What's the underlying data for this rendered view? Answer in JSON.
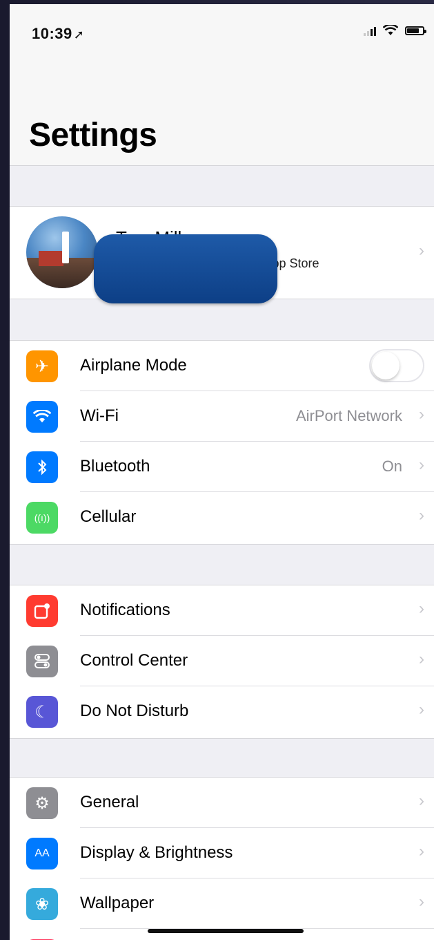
{
  "status_bar": {
    "time": "10:39",
    "location_arrow": "location-arrow-icon",
    "battery_level": 0.7
  },
  "header": {
    "title": "Settings"
  },
  "profile": {
    "name": "Tom Miller",
    "subtitle": "Apple ID, iCloud, iTunes & App Store"
  },
  "groups": {
    "connectivity": [
      {
        "label": "Airplane Mode",
        "icon": "airplane-icon",
        "color": "#ff9500",
        "toggle": false
      },
      {
        "label": "Wi-Fi",
        "icon": "wifi-icon",
        "color": "#007aff",
        "value": "AirPort Network"
      },
      {
        "label": "Bluetooth",
        "icon": "bluetooth-icon",
        "color": "#007aff",
        "value": "On"
      },
      {
        "label": "Cellular",
        "icon": "cellular-icon",
        "color": "#4cd964"
      }
    ],
    "alerts": [
      {
        "label": "Notifications",
        "icon": "notifications-icon",
        "color": "#ff3b30"
      },
      {
        "label": "Control Center",
        "icon": "control-center-icon",
        "color": "#8e8e93"
      },
      {
        "label": "Do Not Disturb",
        "icon": "moon-icon",
        "color": "#5856d6"
      }
    ],
    "system": [
      {
        "label": "General",
        "icon": "gear-icon",
        "color": "#8e8e93"
      },
      {
        "label": "Display & Brightness",
        "icon": "display-brightness-icon",
        "color": "#007aff"
      },
      {
        "label": "Wallpaper",
        "icon": "wallpaper-icon",
        "color": "#35aadc"
      }
    ]
  }
}
